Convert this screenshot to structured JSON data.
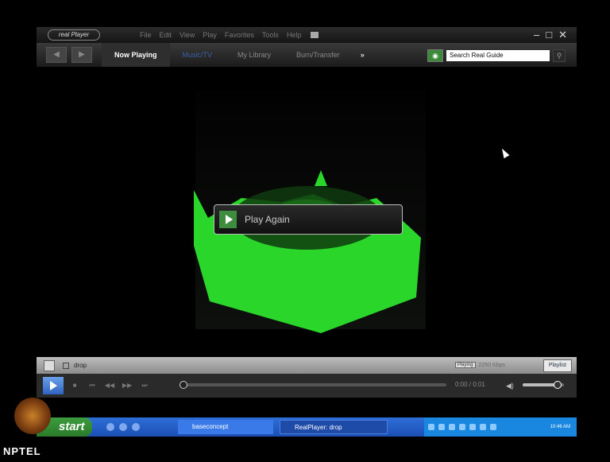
{
  "titlebar": {
    "logo": "real Player",
    "menu": [
      "File",
      "Edit",
      "View",
      "Play",
      "Favorites",
      "Tools",
      "Help"
    ],
    "controls": [
      "–",
      "□",
      "✕"
    ]
  },
  "navbar": {
    "back_icon": "back-arrow-icon",
    "forward_icon": "forward-arrow-icon",
    "tabs": [
      {
        "label": "Now Playing",
        "state": "active"
      },
      {
        "label": "Music/TV",
        "state": "selected"
      },
      {
        "label": "My Library",
        "state": "normal"
      },
      {
        "label": "Burn/Transfer",
        "state": "normal"
      }
    ],
    "more": "»",
    "search_placeholder": "Search Real Guide"
  },
  "video": {
    "play_again_label": "Play Again"
  },
  "status": {
    "clip_title": "drop",
    "badge": "Playing",
    "rate": "2250 Kbps",
    "playlist_label": "Playlist"
  },
  "transport": {
    "time": "0:00 / 0:01",
    "seek_position": 0.0,
    "volume_level": 0.85
  },
  "taskbar": {
    "start_label": "start",
    "tasks": [
      {
        "label": "baseconcept"
      },
      {
        "label": "RealPlayer: drop"
      }
    ],
    "clock": "10:46 AM"
  },
  "watermark": {
    "text": "NPTEL"
  },
  "colors": {
    "accent_green": "#2ee02e",
    "taskbar_blue": "#2d6fd8",
    "start_green": "#3d9b3d"
  }
}
